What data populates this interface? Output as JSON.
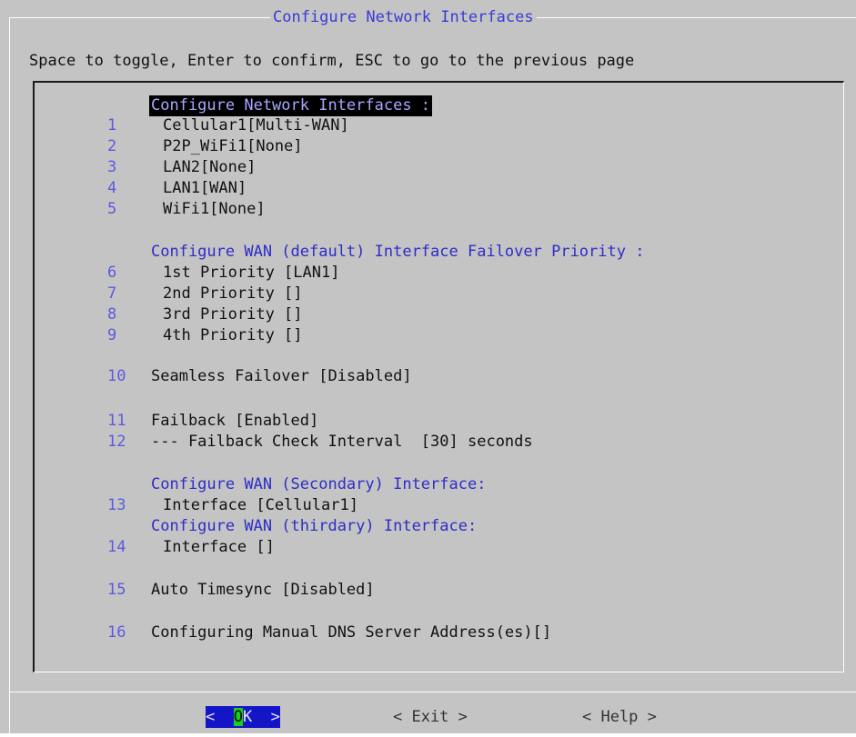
{
  "dialog": {
    "title": "Configure Network Interfaces",
    "instructions": "Space to toggle, Enter to confirm, ESC to go to the previous page"
  },
  "menu": {
    "interfaces_header": "Configure Network Interfaces :",
    "interfaces": [
      {
        "num": "1",
        "label": "Cellular1[Multi-WAN]"
      },
      {
        "num": "2",
        "label": "P2P_WiFi1[None]"
      },
      {
        "num": "3",
        "label": "LAN2[None]"
      },
      {
        "num": "4",
        "label": "LAN1[WAN]"
      },
      {
        "num": "5",
        "label": "WiFi1[None]"
      }
    ],
    "failover_header": "Configure WAN (default) Interface Failover Priority :",
    "priorities": [
      {
        "num": "6",
        "label": "1st Priority [LAN1]"
      },
      {
        "num": "7",
        "label": "2nd Priority []"
      },
      {
        "num": "8",
        "label": "3rd Priority []"
      },
      {
        "num": "9",
        "label": "4th Priority []"
      }
    ],
    "seamless": {
      "num": "10",
      "label": "Seamless Failover [Disabled]"
    },
    "failback": {
      "num": "11",
      "label": "Failback [Enabled]"
    },
    "failback_interval": {
      "num": "12",
      "label": "--- Failback Check Interval  [30] seconds"
    },
    "secondary_header": "Configure WAN (Secondary) Interface:",
    "secondary": {
      "num": "13",
      "label": "Interface [Cellular1]"
    },
    "tertiary_header": "Configure WAN (thirdary) Interface:",
    "tertiary": {
      "num": "14",
      "label": "Interface []"
    },
    "timesync": {
      "num": "15",
      "label": "Auto Timesync [Disabled]"
    },
    "dns": {
      "num": "16",
      "label": "Configuring Manual DNS Server Address(es)[]"
    }
  },
  "buttons": {
    "ok_left": "<  ",
    "ok_hot": "O",
    "ok_rest": "K  >",
    "exit": "< Exit >",
    "help": "< Help >"
  },
  "colors": {
    "background": "#c4c4c4",
    "accent_blue": "#2d2dc8",
    "number_blue": "#5a5ae0",
    "ok_bg": "#1515c8",
    "hotkey_green": "#18d018"
  }
}
